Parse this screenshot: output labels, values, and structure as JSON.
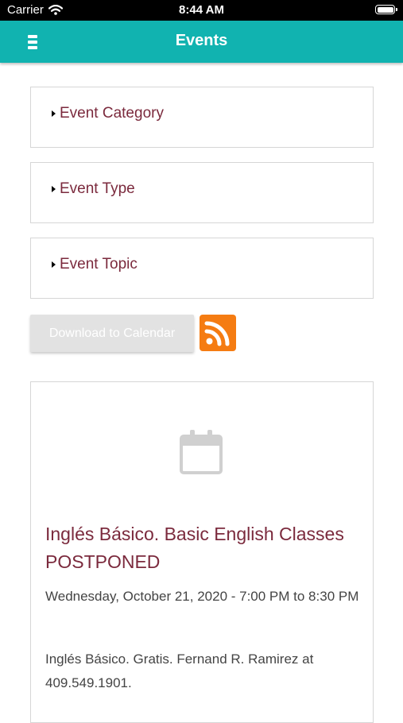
{
  "status_bar": {
    "carrier": "Carrier",
    "time": "8:44 AM"
  },
  "header": {
    "title": "Events",
    "color": "#11b3b0"
  },
  "filters": [
    {
      "label": "Event Category"
    },
    {
      "label": "Event Type"
    },
    {
      "label": "Event Topic"
    }
  ],
  "actions": {
    "download_label": "Download to Calendar",
    "rss_icon": "rss-feed-icon",
    "rss_color": "#f57c12"
  },
  "event": {
    "icon": "calendar-icon",
    "title": "Inglés Básico. Basic English Classes POSTPONED",
    "date": "Wednesday, October 21, 2020 - 7:00 PM to 8:30 PM",
    "description": "Inglés Básico. Gratis. Fernand R. Ramirez at 409.549.1901."
  },
  "colors": {
    "accent_text": "#7b2a3d",
    "body_text": "#444444"
  }
}
